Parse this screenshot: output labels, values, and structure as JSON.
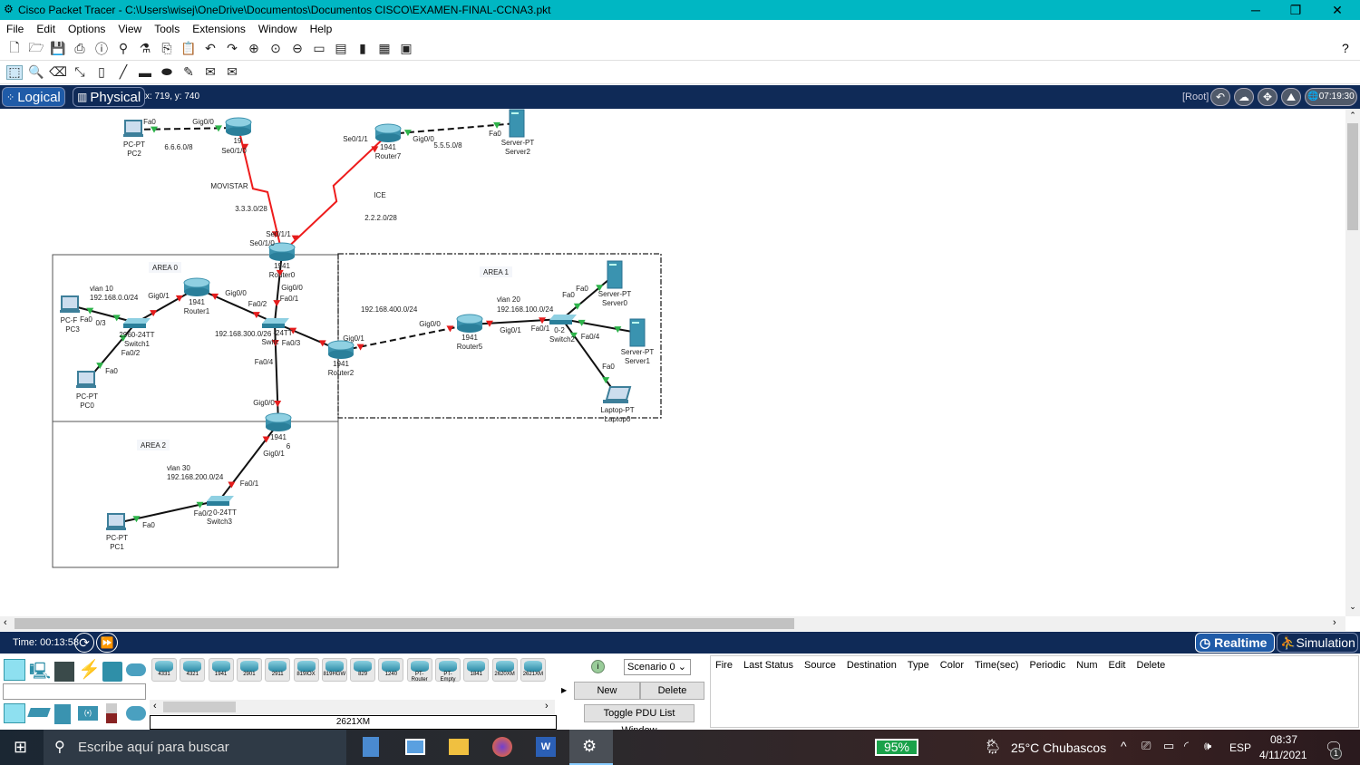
{
  "window": {
    "title": "Cisco Packet Tracer - C:\\Users\\wisej\\OneDrive\\Documentos\\Documentos CISCO\\EXAMEN-FINAL-CCNA3.pkt",
    "minimize": "─",
    "maximize": "❐",
    "close": "✕"
  },
  "menu": [
    "File",
    "Edit",
    "Options",
    "View",
    "Tools",
    "Extensions",
    "Window",
    "Help"
  ],
  "help_icon": "?",
  "nav": {
    "logical": "Logical",
    "physical": "Physical",
    "coords": "x: 719, y: 740",
    "root": "[Root]",
    "clock": "07:19:30"
  },
  "colors": {
    "accent": "#0f2a57",
    "link_up": "#2db34a",
    "link_down": "#e41c1c",
    "serial": "#ee1c1c",
    "device": "#2f8fa8"
  },
  "devices": [
    {
      "id": "PC2",
      "type": "pc",
      "labels": [
        "PC-PT",
        "PC2"
      ]
    },
    {
      "id": "RouterTop",
      "type": "router",
      "labels": [
        "19"
      ]
    },
    {
      "id": "Router7",
      "type": "router",
      "labels": [
        "1941",
        "Router7"
      ]
    },
    {
      "id": "Server2",
      "type": "server",
      "labels": [
        "Server-PT",
        "Server2"
      ]
    },
    {
      "id": "Router0",
      "type": "router",
      "labels": [
        "1941",
        "Router0"
      ]
    },
    {
      "id": "Router1",
      "type": "router",
      "labels": [
        "1941",
        "Router1"
      ]
    },
    {
      "id": "Switch1",
      "type": "switch",
      "labels": [
        "2960-24TT",
        "Switch1"
      ]
    },
    {
      "id": "PC3",
      "type": "pc",
      "labels": [
        "PC-F",
        "PC3"
      ]
    },
    {
      "id": "PC0",
      "type": "pc",
      "labels": [
        "PC-PT",
        "PC0"
      ]
    },
    {
      "id": "Switch0",
      "type": "switch",
      "labels": [
        "-24TT",
        "Switc"
      ]
    },
    {
      "id": "Router2",
      "type": "router",
      "labels": [
        "1941",
        "Router2"
      ]
    },
    {
      "id": "Router6",
      "type": "router",
      "labels": [
        "1941",
        "6"
      ]
    },
    {
      "id": "Switch3",
      "type": "switch",
      "labels": [
        "0-24TT",
        "Switch3"
      ]
    },
    {
      "id": "PC1",
      "type": "pc",
      "labels": [
        "PC-PT",
        "PC1"
      ]
    },
    {
      "id": "Router5",
      "type": "router",
      "labels": [
        "1941",
        "Router5"
      ]
    },
    {
      "id": "Switch2",
      "type": "switch",
      "labels": [
        "0-2",
        "Switch2"
      ]
    },
    {
      "id": "Server0",
      "type": "server",
      "labels": [
        "Server-PT",
        "Server0"
      ]
    },
    {
      "id": "Server1",
      "type": "server",
      "labels": [
        "Server-PT",
        "Server1"
      ]
    },
    {
      "id": "Laptop0",
      "type": "laptop",
      "labels": [
        "Laptop-PT",
        "Laptop0"
      ]
    }
  ],
  "links": [
    {
      "a": "PC2",
      "b": "RouterTop",
      "kind": "cross",
      "status": "up"
    },
    {
      "a": "RouterTop",
      "b": "Router0",
      "kind": "serial",
      "status": "down"
    },
    {
      "a": "Router7",
      "b": "Router0",
      "kind": "serial",
      "status": "down"
    },
    {
      "a": "Router7",
      "b": "Server2",
      "kind": "cross",
      "status": "up"
    },
    {
      "a": "Router0",
      "b": "Switch0",
      "kind": "straight",
      "status": "down"
    },
    {
      "a": "Router1",
      "b": "Switch0",
      "kind": "straight",
      "status": "down"
    },
    {
      "a": "Switch1",
      "b": "Router1",
      "kind": "straight",
      "status": "down"
    },
    {
      "a": "PC3",
      "b": "Switch1",
      "kind": "straight",
      "status": "up"
    },
    {
      "a": "PC0",
      "b": "Switch1",
      "kind": "straight",
      "status": "up"
    },
    {
      "a": "Switch0",
      "b": "Router2",
      "kind": "straight",
      "status": "down"
    },
    {
      "a": "Switch0",
      "b": "Router6",
      "kind": "straight",
      "status": "down"
    },
    {
      "a": "Router2",
      "b": "Router5",
      "kind": "cross",
      "status": "down"
    },
    {
      "a": "Router5",
      "b": "Switch2",
      "kind": "straight",
      "status": "down"
    },
    {
      "a": "Switch2",
      "b": "Server0",
      "kind": "straight",
      "status": "up"
    },
    {
      "a": "Switch2",
      "b": "Server1",
      "kind": "straight",
      "status": "up"
    },
    {
      "a": "Switch2",
      "b": "Laptop0",
      "kind": "straight",
      "status": "up"
    },
    {
      "a": "Router6",
      "b": "Switch3",
      "kind": "straight",
      "status": "down"
    },
    {
      "a": "Switch3",
      "b": "PC1",
      "kind": "straight",
      "status": "up"
    }
  ],
  "areas": [
    "AREA 0",
    "AREA 1",
    "AREA 2"
  ],
  "notes": [
    "vlan 10",
    "192.168.0.0/24",
    "192.168.300.0/26",
    "192.168.400.0/24",
    "vlan 20",
    "192.168.100.0/24",
    "vlan 30",
    "192.168.200.0/24",
    "MOVISTAR",
    "3.3.3.0/28",
    "ICE",
    "2.2.2.0/28",
    "6.6.6.0/8",
    "5.5.5.0/8"
  ],
  "ports": [
    "Fa0",
    "Gig0/0",
    "Se0/1/0",
    "Se0/1/1",
    "Gig0/0",
    "Fa0",
    "Se0/1/1",
    "Se0/1/0",
    "Gig0/0",
    "Fa0/1",
    "Gig0/1",
    "Gig0/0",
    "Fa0/2",
    "Fa0",
    "0/3",
    "Fa0/2",
    "Fa0",
    "Fa0/3",
    "Fa0/4",
    "Gig0/0",
    "Gig0/1",
    "Gig0/0",
    "Gig0/1",
    "Fa0/1",
    "Fa0",
    "Fa0",
    "Fa0/4",
    "Fa0",
    "Gig0/1",
    "Fa0/1",
    "Fa0/2",
    "Fa0"
  ],
  "sim": {
    "time": "Time: 00:13:58",
    "realtime": "Realtime",
    "simulation": "Simulation"
  },
  "models": [
    "4331",
    "4321",
    "1941",
    "2901",
    "2911",
    "819IOX",
    "819HGW",
    "829",
    "1240",
    "PT-Router",
    "PT-Empty",
    "1841",
    "2620XM",
    "2621XM"
  ],
  "selected_model": "2621XM",
  "scenario": {
    "value": "Scenario 0",
    "new": "New",
    "delete": "Delete",
    "toggle": "Toggle PDU List Window"
  },
  "pdu_headers": [
    "Fire",
    "Last Status",
    "Source",
    "Destination",
    "Type",
    "Color",
    "Time(sec)",
    "Periodic",
    "Num",
    "Edit",
    "Delete"
  ],
  "taskbar": {
    "search": "Escribe aquí para buscar",
    "battery": "95%",
    "weather": "25°C  Chubascos",
    "lang": "ESP",
    "time": "08:37",
    "date": "4/11/2021",
    "notif": "1"
  }
}
